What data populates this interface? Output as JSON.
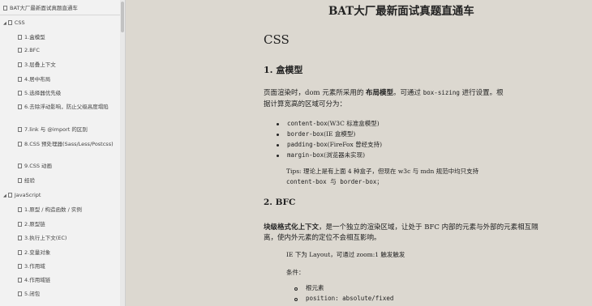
{
  "sidebar": {
    "title": "BAT大厂最新面试真题直通车",
    "groups": [
      {
        "label": "CSS",
        "items": [
          "1.盒模型",
          "2.BFC",
          "3.层叠上下文",
          "4.居中布局",
          "5.选择器优先级",
          "6.去除浮动影响，防止父级高度塌陷",
          "7.link 与 @import 的区别",
          "8.CSS 预处理器(Sass/Less/Postcss)",
          "9.CSS 动画",
          "经验"
        ]
      },
      {
        "label": "JavaScript",
        "items": [
          "1.原型 / 构造函数 / 实例",
          "2.原型链",
          "3.执行上下文(EC)",
          "2.变量对象",
          "3.作用域",
          "4.作用域链",
          "5.闭包"
        ]
      }
    ]
  },
  "doc": {
    "title": "BAT大厂最新面试真题直通车",
    "section": "CSS",
    "h_box": "1. 盒模型",
    "box_para_1a": "页面渲染时，dom 元素所采用的",
    "box_para_1b": "布局模型",
    "box_para_1c": "。可通过",
    "box_para_1d": "box-sizing",
    "box_para_1e": "进行设置。根",
    "box_para_2": "据计算宽高的区域可分为：",
    "bullets": [
      {
        "code": "content-box",
        "text": "(W3C 标准盒模型)"
      },
      {
        "code": "border-box",
        "text": "(IE 盒模型)"
      },
      {
        "code": "padding-box",
        "text": "(FireFox 曾经支持)"
      },
      {
        "code": "margin-box",
        "text": "(浏览器未实现)"
      }
    ],
    "tip_line1": "Tips: 理论上是有上面 4 种盒子，但现在 w3c 与 mdn 规范中均只支持",
    "tip_line2": "content-box 与 border-box；",
    "h_bfc": "2. BFC",
    "bfc_para_1a": "块级格式化上下文",
    "bfc_para_1b": "，是一个独立的渲染区域，让处于 BFC 内部的元素与外部的元素相互隔",
    "bfc_para_2": "离，使内外元素的定位不会相互影响。",
    "ie_line": "IE 下为 Layout，可通过 zoom:1 触发触发",
    "cond_label": "条件：",
    "cond_items": [
      "根元素",
      "position: absolute/fixed"
    ]
  }
}
